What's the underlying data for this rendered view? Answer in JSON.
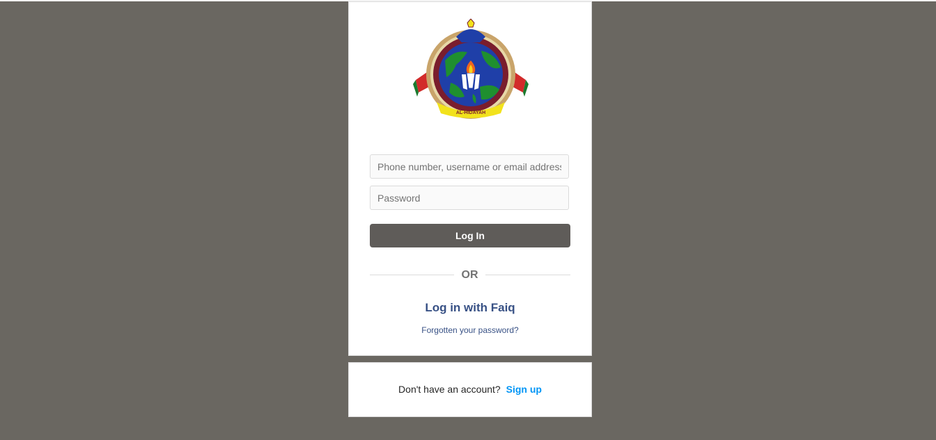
{
  "logo": {
    "icon": "al-hidayah-emblem",
    "text": "AL-HIDAYAH",
    "colors": {
      "globe": "#1f8f2f",
      "ocean": "#1f3fa8",
      "ribbon": "#f2e21c",
      "maroon": "#7a1d2d",
      "flag_red": "#d22b2b",
      "flag_green": "#1a7a2e"
    }
  },
  "form": {
    "username_placeholder": "Phone number, username or email address",
    "password_placeholder": "Password",
    "login_label": "Log In"
  },
  "divider": {
    "text": "OR"
  },
  "alt_login": {
    "label": "Log in with Faiq"
  },
  "forgot": {
    "label": "Forgotten your password?"
  },
  "signup": {
    "prompt": "Don't have an account?",
    "link": "Sign up"
  },
  "colors": {
    "background": "#6a6761",
    "button": "#5f5c59",
    "link_dark": "#385185",
    "link_blue": "#0095f6"
  }
}
